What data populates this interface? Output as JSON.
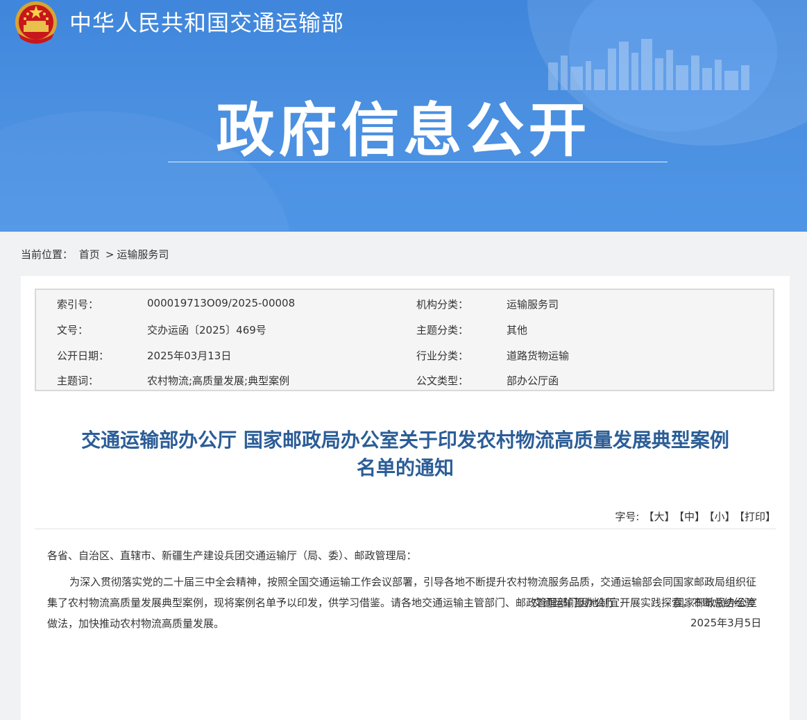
{
  "header": {
    "ministry_name": "中华人民共和国交通运输部",
    "section_title": "政府信息公开"
  },
  "breadcrumb": {
    "label": "当前位置：",
    "items": [
      "首页",
      "运输服务司"
    ],
    "separator": ">"
  },
  "meta": {
    "rows": [
      {
        "l1": "索引号：",
        "v1": "000019713O09/2025-00008",
        "l2": "机构分类：",
        "v2": "运输服务司"
      },
      {
        "l1": "文号：",
        "v1": "交办运函〔2025〕469号",
        "l2": "主题分类：",
        "v2": "其他"
      },
      {
        "l1": "公开日期：",
        "v1": "2025年03月13日",
        "l2": "行业分类：",
        "v2": "道路货物运输"
      },
      {
        "l1": "主题词：",
        "v1": "农村物流;高质量发展;典型案例",
        "l2": "公文类型：",
        "v2": "部办公厅函"
      }
    ]
  },
  "article": {
    "title_line1": "交通运输部办公厅 国家邮政局办公室关于印发农村物流高质量发展典型案例",
    "title_line2": "名单的通知",
    "fontsize_label": "字号:",
    "fontsize_large": "【大】",
    "fontsize_medium": "【中】",
    "fontsize_small": "【小】",
    "print": "【打印】",
    "salutation": "各省、自治区、直辖市、新疆生产建设兵团交通运输厅（局、委）、邮政管理局：",
    "paragraph1": "为深入贯彻落实党的二十届三中全会精神，按照全国交通运输工作会议部署，引导各地不断提升农村物流服务品质，交通运输部会同国家邮政局组织征集了农村物流高质量发展典型案例，现将案例名单予以印发，供学习借鉴。请各地交通运输主管部门、邮政管理部门因地制宜开展实践探索，不断总结经验做法，加快推动农村物流高质量发展。",
    "signer1": "交通运输部办公厅",
    "signer2": "国家邮政局办公室",
    "date": "2025年3月5日"
  },
  "colors": {
    "banner_blue": "#4a8fe0",
    "title_blue": "#2b5d97"
  }
}
